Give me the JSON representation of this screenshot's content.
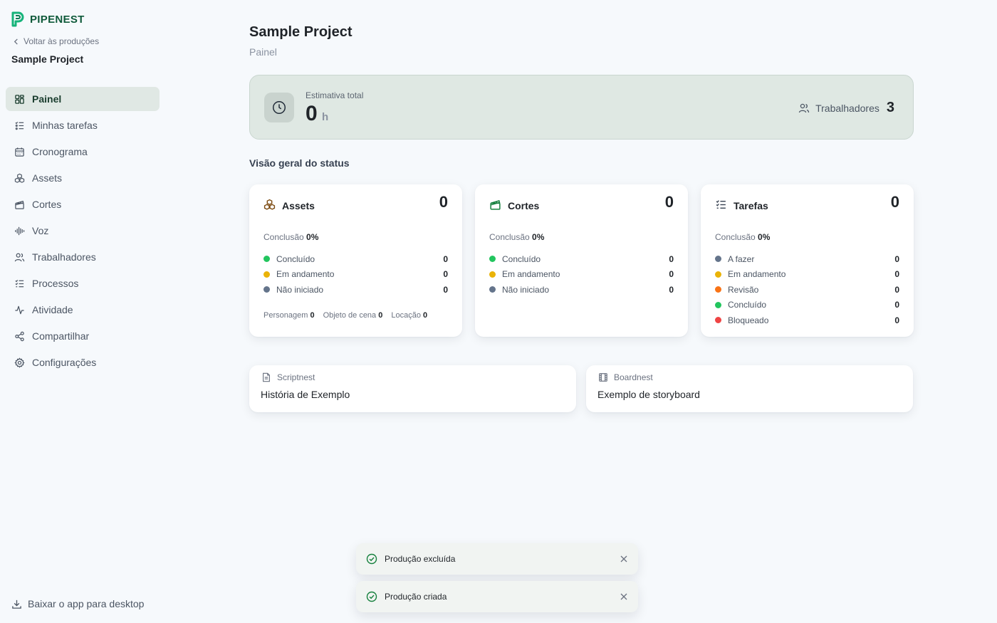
{
  "brand": {
    "name": "PIPENEST"
  },
  "sidebar": {
    "back_label": "Voltar às produções",
    "project_name": "Sample Project",
    "items": [
      {
        "label": "Painel",
        "icon": "dashboard-icon",
        "active": true
      },
      {
        "label": "Minhas tarefas",
        "icon": "task-list-icon"
      },
      {
        "label": "Cronograma",
        "icon": "calendar-icon"
      },
      {
        "label": "Assets",
        "icon": "boxes-icon"
      },
      {
        "label": "Cortes",
        "icon": "clapperboard-icon"
      },
      {
        "label": "Voz",
        "icon": "audio-wave-icon"
      },
      {
        "label": "Trabalhadores",
        "icon": "users-icon"
      },
      {
        "label": "Processos",
        "icon": "checklist-icon"
      },
      {
        "label": "Atividade",
        "icon": "activity-icon"
      },
      {
        "label": "Compartilhar",
        "icon": "share-icon"
      },
      {
        "label": "Configurações",
        "icon": "settings-icon"
      }
    ],
    "download_label": "Baixar o app para desktop"
  },
  "header": {
    "title": "Sample Project",
    "subtitle": "Painel"
  },
  "summary": {
    "estimate_label": "Estimativa total",
    "estimate_value": "0",
    "estimate_unit": "h",
    "workers_label": "Trabalhadores",
    "workers_count": "3"
  },
  "status_overview": {
    "title": "Visão geral do status",
    "progress_label": "Conclusão",
    "cards": [
      {
        "title": "Assets",
        "icon": "boxes-icon",
        "total": "0",
        "progress": "0%",
        "statuses": [
          {
            "label": "Concluído",
            "value": "0",
            "color": "#22c55e"
          },
          {
            "label": "Em andamento",
            "value": "0",
            "color": "#eab308"
          },
          {
            "label": "Não iniciado",
            "value": "0",
            "color": "#64748b"
          }
        ],
        "types": [
          {
            "label": "Personagem",
            "value": "0"
          },
          {
            "label": "Objeto de cena",
            "value": "0"
          },
          {
            "label": "Locação",
            "value": "0"
          }
        ]
      },
      {
        "title": "Cortes",
        "icon": "clapperboard-icon",
        "total": "0",
        "progress": "0%",
        "statuses": [
          {
            "label": "Concluído",
            "value": "0",
            "color": "#22c55e"
          },
          {
            "label": "Em andamento",
            "value": "0",
            "color": "#eab308"
          },
          {
            "label": "Não iniciado",
            "value": "0",
            "color": "#64748b"
          }
        ]
      },
      {
        "title": "Tarefas",
        "icon": "checklist-icon",
        "total": "0",
        "progress": "0%",
        "statuses": [
          {
            "label": "A fazer",
            "value": "0",
            "color": "#64748b"
          },
          {
            "label": "Em andamento",
            "value": "0",
            "color": "#eab308"
          },
          {
            "label": "Revisão",
            "value": "0",
            "color": "#f97316"
          },
          {
            "label": "Concluído",
            "value": "0",
            "color": "#22c55e"
          },
          {
            "label": "Bloqueado",
            "value": "0",
            "color": "#ef4444"
          }
        ]
      }
    ]
  },
  "links": [
    {
      "app": "Scriptnest",
      "icon": "document-icon",
      "title": "História de Exemplo"
    },
    {
      "app": "Boardnest",
      "icon": "film-icon",
      "title": "Exemplo de storyboard"
    }
  ],
  "toasts": [
    {
      "message": "Produção excluída"
    },
    {
      "message": "Produção criada"
    }
  ],
  "colors": {
    "brand": "#16a34a",
    "active_nav": "#e0e8e4",
    "summary_bg": "#dfe8e3"
  }
}
